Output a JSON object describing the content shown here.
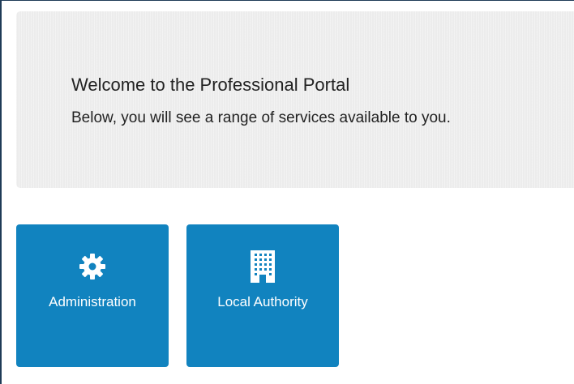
{
  "welcome": {
    "title": "Welcome to the Professional Portal",
    "subtitle": "Below, you will see a range of services available to you."
  },
  "tiles": [
    {
      "label": "Administration",
      "icon": "gear-icon"
    },
    {
      "label": "Local Authority",
      "icon": "building-icon"
    }
  ],
  "colors": {
    "tile_background": "#1183bf",
    "banner_background": "#ececec",
    "text": "#222222",
    "frame_border": "#1f3b57"
  }
}
